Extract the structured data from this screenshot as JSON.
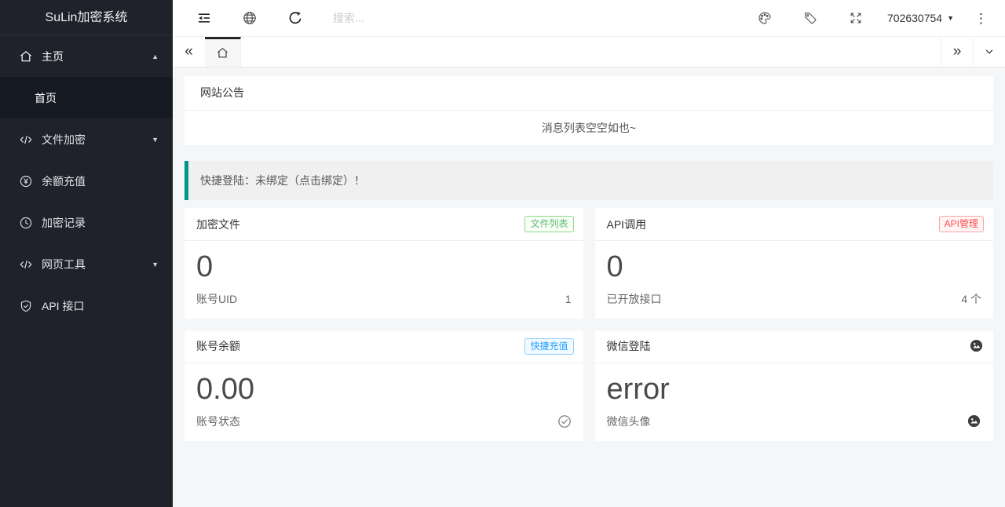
{
  "app": {
    "title": "SuLin加密系统"
  },
  "colors": {
    "sidebar_bg": "#1f222b",
    "sidebar_active_bg": "#161a22",
    "alert_accent_teal": "#009688",
    "badge_green": "#5fb878",
    "badge_blue": "#1e9fff",
    "badge_red": "#ff4d4d",
    "tab_active_border": "#262626",
    "page_bg": "#f5f6f8"
  },
  "glyphs": {
    "caret_up": "▲",
    "caret_down": "▼",
    "chevron_double_left": "«",
    "chevron_double_right": "»",
    "kebab": "⋮"
  },
  "sidebar": {
    "items": {
      "home": {
        "label": "主页"
      },
      "index": {
        "label": "首页"
      },
      "file_encrypt": {
        "label": "文件加密"
      },
      "recharge": {
        "label": "余额充值"
      },
      "records": {
        "label": "加密记录"
      },
      "web_tools": {
        "label": "网页工具"
      },
      "api": {
        "label": "API 接口"
      }
    }
  },
  "toolbar": {
    "search_placeholder": "搜索...",
    "user_id": "702630754"
  },
  "announcement": {
    "title": "网站公告",
    "empty_text": "消息列表空空如也~"
  },
  "alert": {
    "text": "快捷登陆：未绑定（点击绑定）！"
  },
  "stats": {
    "encrypt_files": {
      "title": "加密文件",
      "badge": "文件列表",
      "value": "0",
      "footer_label": "账号UID",
      "footer_value": "1"
    },
    "api_calls": {
      "title": "API调用",
      "badge": "API管理",
      "value": "0",
      "footer_label": "已开放接口",
      "footer_value": "4 个"
    },
    "balance": {
      "title": "账号余额",
      "badge": "快捷充值",
      "value": "0.00",
      "footer_label": "账号状态"
    },
    "wechat": {
      "title": "微信登陆",
      "value": "error",
      "footer_label": "微信头像"
    }
  }
}
